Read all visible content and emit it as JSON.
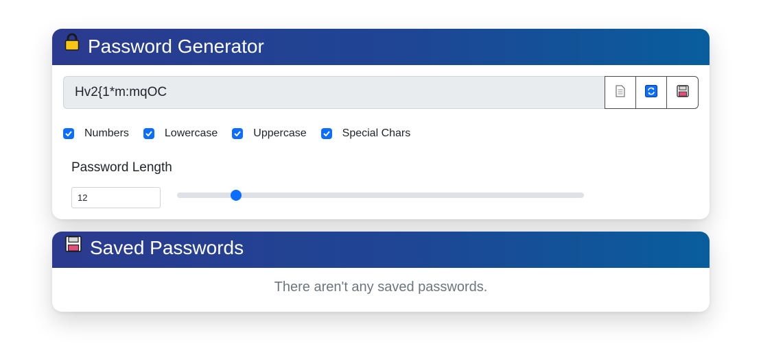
{
  "generator": {
    "title": "Password Generator",
    "header_icon": "lock-icon",
    "password_value": "Hv2{1*m:mqOC",
    "buttons": [
      {
        "icon": "copy-document-icon"
      },
      {
        "icon": "refresh-icon",
        "accent": "#0d6efd"
      },
      {
        "icon": "floppy-save-icon"
      }
    ],
    "options": [
      {
        "label": "Numbers",
        "checked": true
      },
      {
        "label": "Lowercase",
        "checked": true
      },
      {
        "label": "Uppercase",
        "checked": true
      },
      {
        "label": "Special Chars",
        "checked": true
      }
    ],
    "length_label": "Password Length",
    "length_value": "12",
    "slider_fraction": 0.145
  },
  "saved": {
    "title": "Saved Passwords",
    "header_icon": "floppy-disk-icon",
    "empty_message": "There aren't any saved passwords."
  },
  "colors": {
    "header_gradient_start": "#2b3a8f",
    "header_gradient_end": "#085e9c",
    "accent": "#0d6efd"
  }
}
